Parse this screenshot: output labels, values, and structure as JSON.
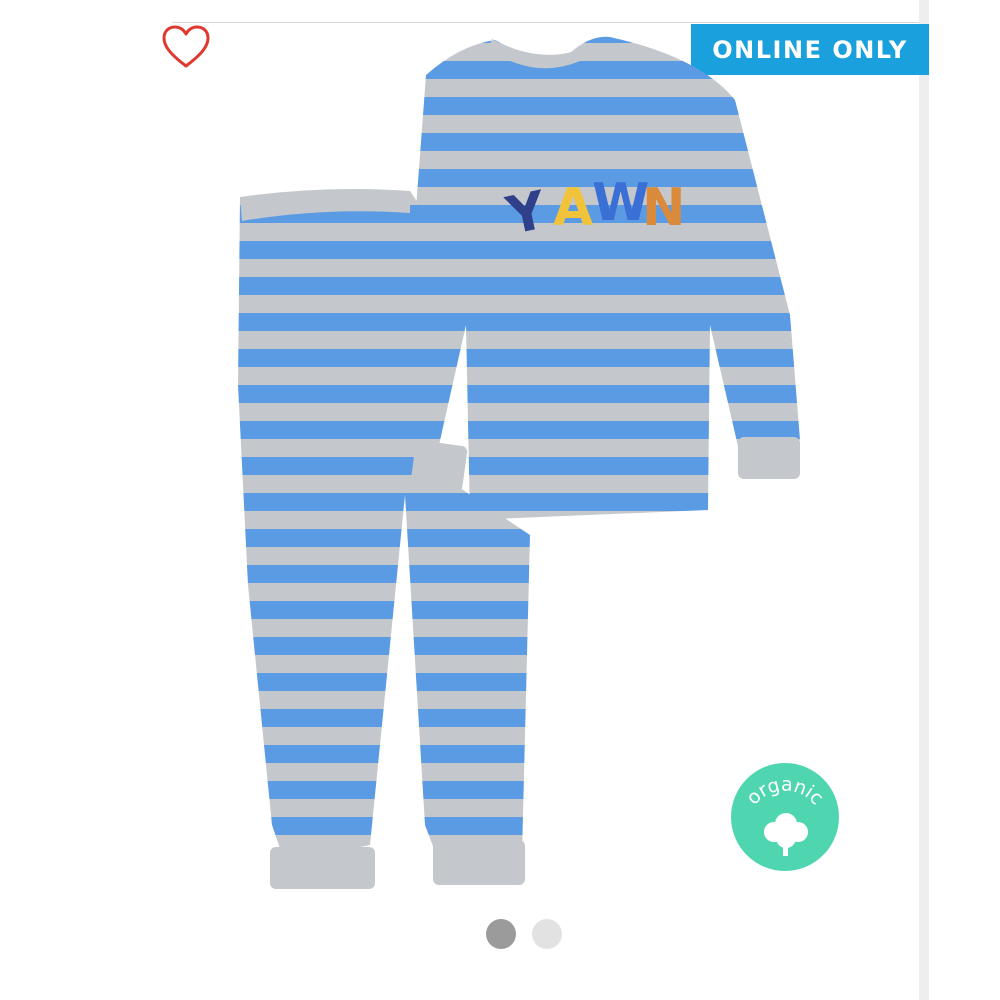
{
  "favorite": {
    "icon": "heart-outline-icon",
    "color": "#e0382f"
  },
  "badge": {
    "label": "ONLINE ONLY",
    "color": "#1aa0dc"
  },
  "product": {
    "image": "striped-pajama-set-image",
    "shirt_text": "YAWN",
    "stripe_blue": "#5b9be4",
    "stripe_grey": "#c4c8cc"
  },
  "organic_badge": {
    "label": "organic",
    "icon": "cotton-flower-icon",
    "color": "#4fd6b0"
  },
  "carousel": {
    "active_index": 0,
    "count": 2,
    "active_color": "#9b9b9b",
    "inactive_color": "#e2e2e2"
  }
}
